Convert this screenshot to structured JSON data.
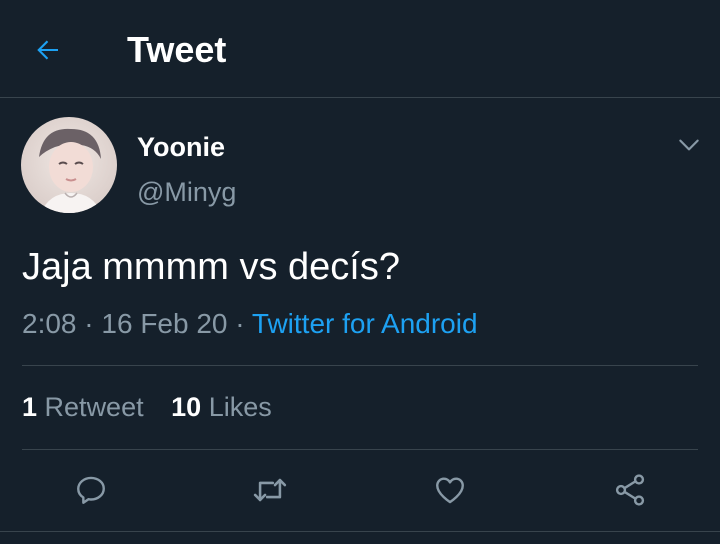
{
  "header": {
    "title": "Tweet",
    "back_icon": "arrow-left-icon"
  },
  "tweet": {
    "display_name": "Yoonie",
    "handle": "@Minyg",
    "text": "Jaja mmmm vs decís?",
    "time": "2:08",
    "separator": "·",
    "date": "16 Feb 20",
    "source": "Twitter for Android"
  },
  "stats": {
    "retweets_count": "1",
    "retweets_label": "Retweet",
    "likes_count": "10",
    "likes_label": "Likes"
  },
  "actions": [
    "reply-icon",
    "retweet-icon",
    "like-icon",
    "share-icon"
  ],
  "colors": {
    "background": "#15202b",
    "accent": "#1da1f2",
    "secondary_text": "#8899a6",
    "divider": "#38444d"
  }
}
